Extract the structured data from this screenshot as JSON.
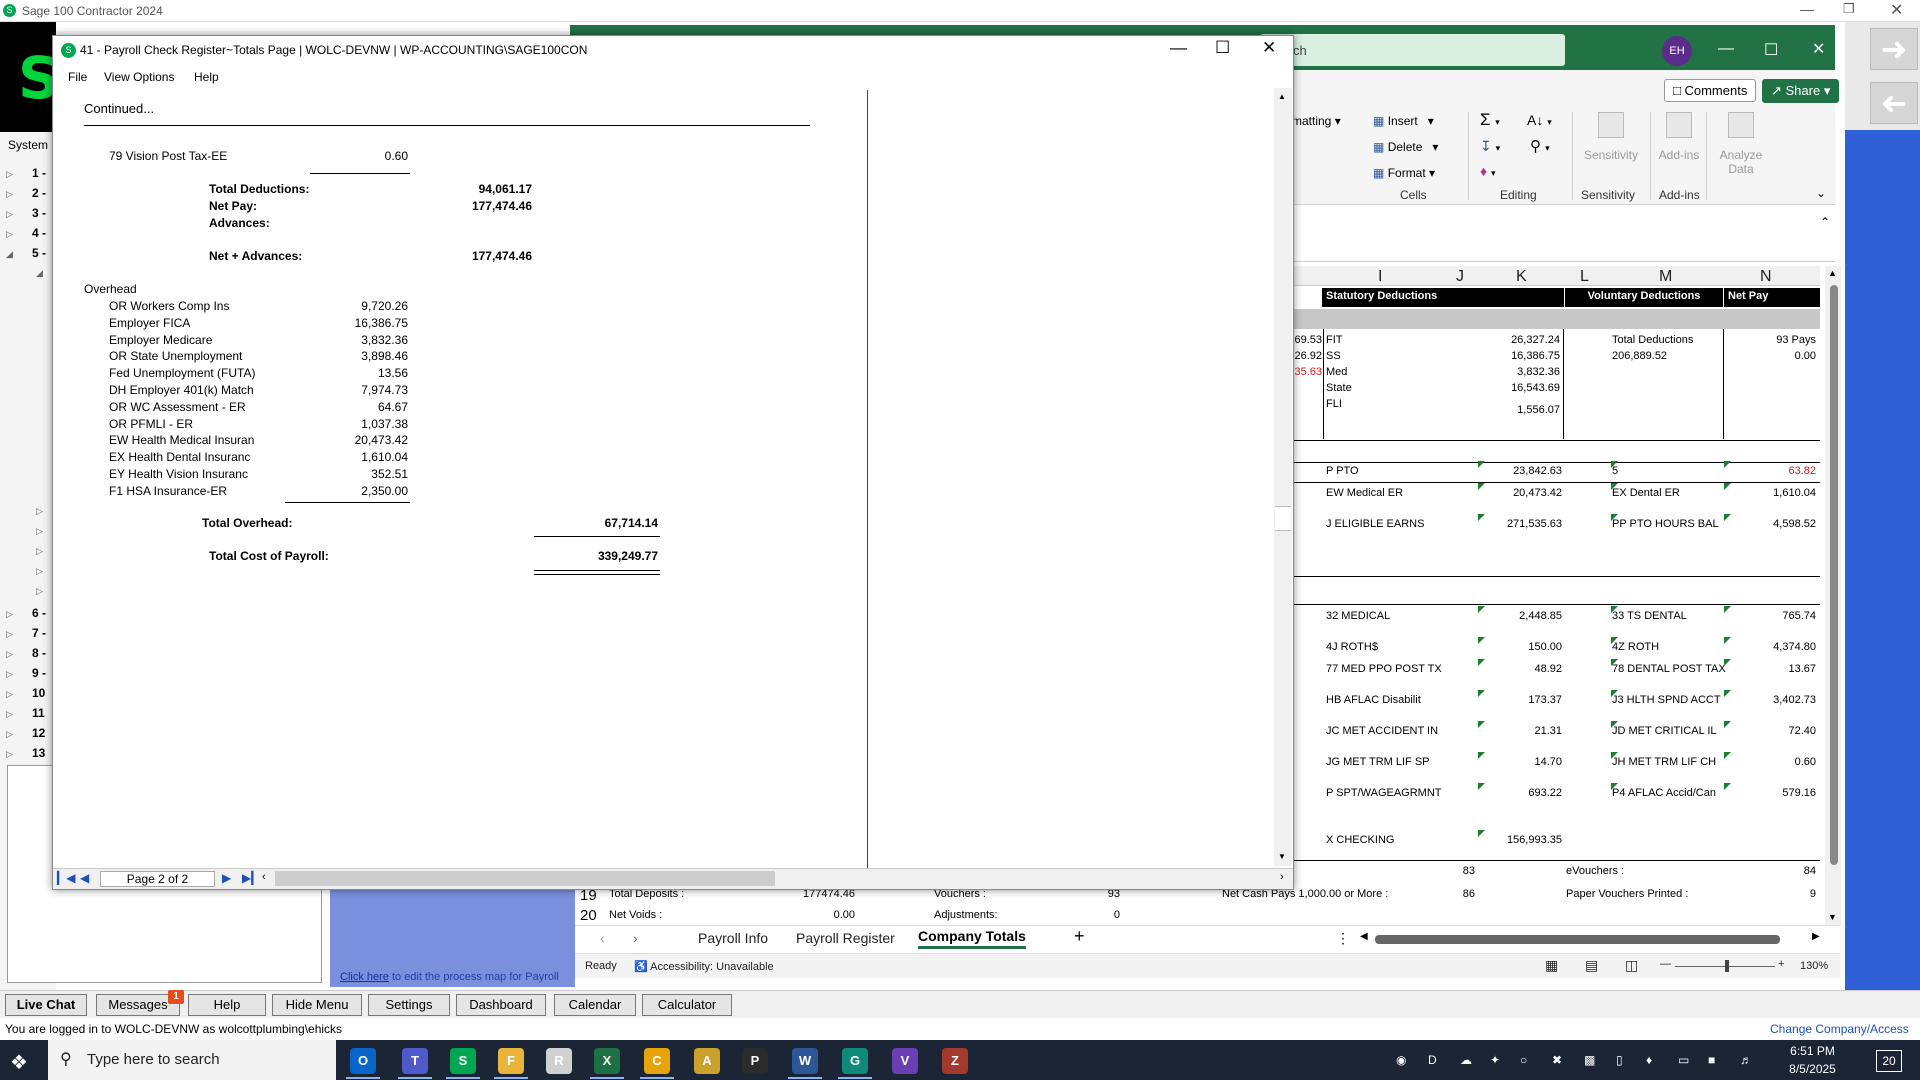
{
  "sage": {
    "title": "Sage 100 Contractor 2024",
    "system_menu_label": "System M",
    "tree_items": [
      "1 -",
      "2 -",
      "3 -",
      "4 -",
      "5 -",
      "6 -",
      "7 -",
      "8 -",
      "9 -",
      "10",
      "11",
      "12",
      "13"
    ],
    "process_map_link": "Click here",
    "process_map_text": " to edit the process map for Payroll",
    "bottom_nav": [
      "Live Chat",
      "Messages",
      "Help",
      "Hide Menu",
      "Settings",
      "Dashboard",
      "Calendar",
      "Calculator"
    ],
    "messages_badge": "1",
    "login_text": "You are logged in to WOLC-DEVNW as wolcottplumbing\\ehicks",
    "change_company": "Change Company/Access"
  },
  "excel": {
    "search_text": "ch",
    "avatar": "EH",
    "comments": "Comments",
    "share": "Share",
    "ribbon": {
      "formatting": "matting",
      "insert": "Insert",
      "delete": "Delete",
      "format": "Format",
      "cells_group": "Cells",
      "editing_group": "Editing",
      "sensitivity": "Sensitivity",
      "sensitivity_group": "Sensitivity",
      "addins": "Add-ins",
      "addins_group": "Add-ins",
      "analyze": "Analyze",
      "analyze2": "Data"
    },
    "columns": [
      "I",
      "J",
      "K",
      "L",
      "M",
      "N"
    ],
    "headers": {
      "stat": "Statutory Deductions",
      "vol": "Voluntary Deductions",
      "net": "Net Pay"
    },
    "left_partials": [
      "69.53",
      "26.92",
      "35.63"
    ],
    "stat_rows": [
      {
        "label": "FIT",
        "value": "26,327.24"
      },
      {
        "label": "SS",
        "value": "16,386.75"
      },
      {
        "label": "Med",
        "value": "3,832.36"
      },
      {
        "label": "State",
        "value": "16,543.69"
      },
      {
        "label": "FLI",
        "value": "1,556.07"
      }
    ],
    "vol": {
      "label": "Total Deductions",
      "value": "206,889.52"
    },
    "net": {
      "pays": "93 Pays",
      "value": "0.00"
    },
    "rows": [
      {
        "a": "P PTO",
        "av": "23,842.63",
        "b": "5",
        "bv": "63.82"
      },
      {
        "a": "EW Medical ER",
        "av": "20,473.42",
        "b": "EX Dental ER",
        "bv": "1,610.04"
      },
      {
        "a": "J ELIGIBLE EARNS",
        "av": "271,535.63",
        "b": "PP PTO HOURS BAL",
        "bv": "4,598.52"
      },
      {
        "a": "32 MEDICAL",
        "av": "2,448.85",
        "b": "33 TS DENTAL",
        "bv": "765.74"
      },
      {
        "a": "4J ROTH$",
        "av": "150.00",
        "b": "4Z ROTH",
        "bv": "4,374.80"
      },
      {
        "a": "77 MED PPO POST TX",
        "av": "48.92",
        "b": "78 DENTAL POST TAX",
        "bv": "13.67"
      },
      {
        "a": "HB AFLAC Disabilit",
        "av": "173.37",
        "b": "J3 HLTH SPND ACCT",
        "bv": "3,402.73"
      },
      {
        "a": "JC MET ACCIDENT IN",
        "av": "21.31",
        "b": "JD MET CRITICAL IL",
        "bv": "72.40"
      },
      {
        "a": "JG MET TRM LIF SP",
        "av": "14.70",
        "b": "JH MET TRM LIF CH",
        "bv": "0.60"
      },
      {
        "a": "P SPT/WAGEAGRMNT",
        "av": "693.22",
        "b": "P4 AFLAC Accid/Can",
        "bv": "579.16"
      },
      {
        "a": "X CHECKING",
        "av": "156,993.35",
        "b": "",
        "bv": ""
      }
    ],
    "summary": {
      "v83": "83",
      "evouchers": "eVouchers :",
      "v84": "84",
      "row19": "19",
      "row20": "20",
      "total_deposits": "Total Deposits :",
      "total_deposits_val": "177474.46",
      "vouchers": "Vouchers :",
      "vouchers_val": "93",
      "net_voids": "Net Voids :",
      "net_voids_val": "0.00",
      "adjustments": "Adjustments:",
      "adjustments_val": "0",
      "net_cash": "Net Cash Pays 1,000.00 or More :",
      "net_cash_val": "86",
      "paper": "Paper Vouchers Printed :",
      "paper_val": "9"
    },
    "tabs": [
      "Payroll Info",
      "Payroll Register",
      "Company Totals"
    ],
    "status_ready": "Ready",
    "status_access": "Accessibility: Unavailable",
    "zoom": "130%"
  },
  "report": {
    "title": "41 - Payroll Check Register~Totals Page  |  WOLC-DEVNW  |  WP-ACCOUNTING\\SAGE100CON",
    "menu": [
      "File",
      "View Options",
      "Help"
    ],
    "continued": "Continued...",
    "vision": {
      "label": "79 Vision Post Tax-EE",
      "value": "0.60"
    },
    "totals": [
      {
        "label": "Total Deductions:",
        "value": "94,061.17"
      },
      {
        "label": "Net Pay:",
        "value": "177,474.46"
      },
      {
        "label": "Advances:",
        "value": ""
      }
    ],
    "net_adv": {
      "label": "Net + Advances:",
      "value": "177,474.46"
    },
    "overhead_title": "Overhead",
    "overhead": [
      {
        "label": "OR Workers Comp Ins",
        "value": "9,720.26"
      },
      {
        "label": "Employer FICA",
        "value": "16,386.75"
      },
      {
        "label": "Employer Medicare",
        "value": "3,832.36"
      },
      {
        "label": "OR State Unemployment",
        "value": "3,898.46"
      },
      {
        "label": "Fed Unemployment (FUTA)",
        "value": "13.56"
      },
      {
        "label": "DH Employer 401(k) Match",
        "value": "7,974.73"
      },
      {
        "label": "OR WC Assessment - ER",
        "value": "64.67"
      },
      {
        "label": "OR PFMLI - ER",
        "value": "1,037.38"
      },
      {
        "label": "EW Health Medical Insuran",
        "value": "20,473.42"
      },
      {
        "label": "EX Health Dental Insuranc",
        "value": "1,610.04"
      },
      {
        "label": "EY Health Vision Insuranc",
        "value": "352.51"
      },
      {
        "label": "F1 HSA Insurance-ER",
        "value": "2,350.00"
      }
    ],
    "total_overhead": {
      "label": "Total Overhead:",
      "value": "67,714.14"
    },
    "total_cost": {
      "label": "Total Cost of Payroll:",
      "value": "339,249.77"
    },
    "page_indicator": "Page 2 of 2"
  },
  "taskbar": {
    "search_placeholder": "Type here to search",
    "time": "6:51 PM",
    "date": "8/5/2025",
    "notifications": "20",
    "apps": [
      {
        "name": "outlook-icon",
        "glyph": "O",
        "color": "#0a64c8"
      },
      {
        "name": "teams-icon",
        "glyph": "T",
        "color": "#5059c9"
      },
      {
        "name": "sage-icon",
        "glyph": "S",
        "color": "#00a651"
      },
      {
        "name": "file-explorer-icon",
        "glyph": "F",
        "color": "#e8b53a"
      },
      {
        "name": "remote-desktop-icon",
        "glyph": "R",
        "color": "#d0d0d0"
      },
      {
        "name": "excel-icon",
        "glyph": "X",
        "color": "#1e7145"
      },
      {
        "name": "chrome-icon",
        "glyph": "C",
        "color": "#e5a50a"
      },
      {
        "name": "app-icon",
        "glyph": "A",
        "color": "#caa12b"
      },
      {
        "name": "acrobat-icon",
        "glyph": "P",
        "color": "#2b2b2b"
      },
      {
        "name": "word-icon",
        "glyph": "W",
        "color": "#2b5797"
      },
      {
        "name": "chatgpt-icon",
        "glyph": "G",
        "color": "#0f8a78"
      },
      {
        "name": "visual-studio-icon",
        "glyph": "V",
        "color": "#6a3fb4"
      },
      {
        "name": "winrar-icon",
        "glyph": "Z",
        "color": "#a3382c"
      }
    ]
  },
  "colors": {
    "excel_green": "#217346",
    "sage_green": "#00a651",
    "sage_blue": "#2f60d8"
  }
}
